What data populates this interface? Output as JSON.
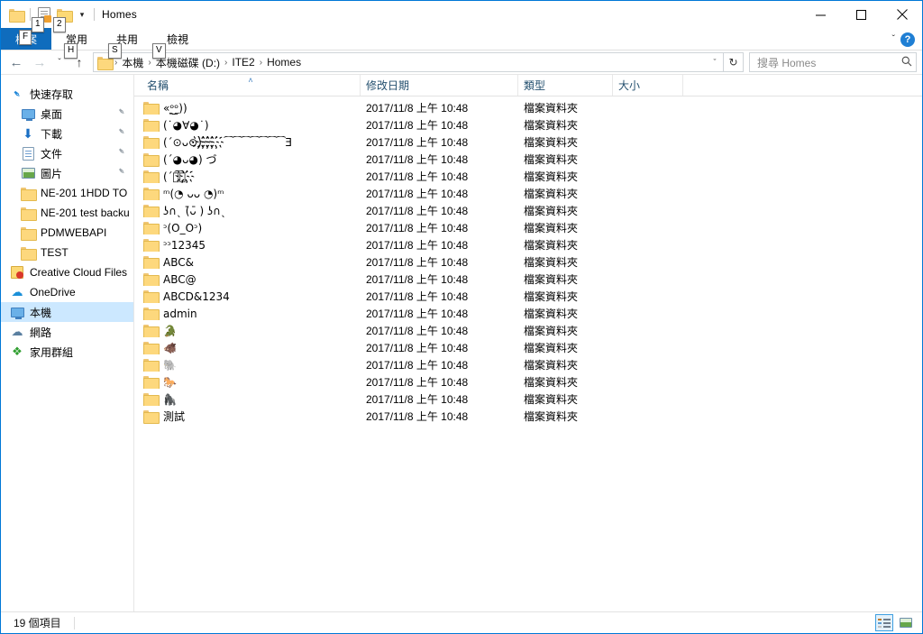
{
  "window": {
    "title": "Homes",
    "minimize_label": "─",
    "maximize_label": "□",
    "close_label": "✕"
  },
  "quick_access_toolbar": {
    "items": [
      {
        "name": "folder-icon",
        "keytip": ""
      },
      {
        "name": "properties-icon",
        "keytip": "1"
      },
      {
        "name": "new-folder-icon",
        "keytip": "2"
      }
    ],
    "customize_caret": "▾"
  },
  "ribbon": {
    "tabs": [
      {
        "label": "檔案",
        "keytip": "F",
        "selected": true
      },
      {
        "label": "常用",
        "keytip": "H",
        "selected": false
      },
      {
        "label": "共用",
        "keytip": "S",
        "selected": false
      },
      {
        "label": "檢視",
        "keytip": "V",
        "selected": false
      }
    ],
    "collapse_caret": "ˇ",
    "help_label": "?"
  },
  "address_bar": {
    "back_label": "←",
    "forward_label": "→",
    "history_label": "ˇ",
    "up_label": "↑",
    "breadcrumbs": [
      "本機",
      "本機磁碟 (D:)",
      "ITE2",
      "Homes"
    ],
    "separator": "›",
    "dropdown_caret": "ˇ",
    "refresh_label": "↻"
  },
  "search": {
    "placeholder": "搜尋 Homes",
    "icon_label": "⌕"
  },
  "sidebar": {
    "items": [
      {
        "label": "快速存取",
        "icon": "pin-blue-icon",
        "level": "root",
        "pinned": false,
        "selected": false
      },
      {
        "label": "桌面",
        "icon": "desktop-icon",
        "level": "sub",
        "pinned": true,
        "selected": false
      },
      {
        "label": "下載",
        "icon": "downloads-icon",
        "level": "sub",
        "pinned": true,
        "selected": false
      },
      {
        "label": "文件",
        "icon": "documents-icon",
        "level": "sub",
        "pinned": true,
        "selected": false
      },
      {
        "label": "圖片",
        "icon": "pictures-icon",
        "level": "sub",
        "pinned": true,
        "selected": false
      },
      {
        "label": "NE-201  1HDD TO",
        "icon": "folder-icon",
        "level": "sub",
        "pinned": false,
        "selected": false
      },
      {
        "label": "NE-201 test backu",
        "icon": "folder-icon",
        "level": "sub",
        "pinned": false,
        "selected": false
      },
      {
        "label": "PDMWEBAPI",
        "icon": "folder-icon",
        "level": "sub",
        "pinned": false,
        "selected": false
      },
      {
        "label": "TEST",
        "icon": "folder-icon",
        "level": "sub",
        "pinned": false,
        "selected": false
      },
      {
        "label": "Creative Cloud Files",
        "icon": "creative-cloud-icon",
        "level": "root",
        "pinned": false,
        "selected": false
      },
      {
        "label": "OneDrive",
        "icon": "onedrive-icon",
        "level": "root",
        "pinned": false,
        "selected": false
      },
      {
        "label": "本機",
        "icon": "this-pc-icon",
        "level": "root",
        "pinned": false,
        "selected": true
      },
      {
        "label": "網路",
        "icon": "network-icon",
        "level": "root",
        "pinned": false,
        "selected": false
      },
      {
        "label": "家用群組",
        "icon": "homegroup-icon",
        "level": "root",
        "pinned": false,
        "selected": false
      }
    ]
  },
  "file_list": {
    "columns": [
      {
        "label": "名稱",
        "sorted": true,
        "sort_arrow": "˄"
      },
      {
        "label": "修改日期",
        "sorted": false,
        "sort_arrow": ""
      },
      {
        "label": "類型",
        "sorted": false,
        "sort_arrow": ""
      },
      {
        "label": "大小",
        "sorted": false,
        "sort_arrow": ""
      }
    ],
    "rows": [
      {
        "name": "«ᵒ̯͜ᵒ̯))",
        "date": "2017/11/8 上午 10:48",
        "type": "檔案資料夾",
        "size": ""
      },
      {
        "name": "(˙◕∀◕˙)",
        "date": "2017/11/8 上午 10:48",
        "type": "檔案資料夾",
        "size": ""
      },
      {
        "name": "(´⊙ᴗ⊙)҉҉҉҉҉⁀⁀⁀⁀⁀⁀⁀Ǝ",
        "date": "2017/11/8 上午 10:48",
        "type": "檔案資料夾",
        "size": ""
      },
      {
        "name": "(´◕ᴗ◕) づ",
        "date": "2017/11/8 上午 10:48",
        "type": "檔案資料夾",
        "size": ""
      },
      {
        "name": "(´⍟͡⍟҉҉",
        "date": "2017/11/8 上午 10:48",
        "type": "檔案資料夾",
        "size": ""
      },
      {
        "name": "ᵐ(◔ ᴗᴗ ◔)ᵐ",
        "date": "2017/11/8 上午 10:48",
        "type": "檔案資料夾",
        "size": ""
      },
      {
        "name": "ʖ∩ˎ (̄ᴗ̄ ) ʖ∩ˎ",
        "date": "2017/11/8 上午 10:48",
        "type": "檔案資料夾",
        "size": ""
      },
      {
        "name": "ᵓ(O_Oᵓ)",
        "date": "2017/11/8 上午 10:48",
        "type": "檔案資料夾",
        "size": ""
      },
      {
        "name": "ᵓᵓ12345",
        "date": "2017/11/8 上午 10:48",
        "type": "檔案資料夾",
        "size": ""
      },
      {
        "name": "ABC&",
        "date": "2017/11/8 上午 10:48",
        "type": "檔案資料夾",
        "size": ""
      },
      {
        "name": "ABC@",
        "date": "2017/11/8 上午 10:48",
        "type": "檔案資料夾",
        "size": ""
      },
      {
        "name": "ABCD&1234",
        "date": "2017/11/8 上午 10:48",
        "type": "檔案資料夾",
        "size": ""
      },
      {
        "name": "admin",
        "date": "2017/11/8 上午 10:48",
        "type": "檔案資料夾",
        "size": ""
      },
      {
        "name": "🐊",
        "date": "2017/11/8 上午 10:48",
        "type": "檔案資料夾",
        "size": ""
      },
      {
        "name": "🐗",
        "date": "2017/11/8 上午 10:48",
        "type": "檔案資料夾",
        "size": ""
      },
      {
        "name": "🐘",
        "date": "2017/11/8 上午 10:48",
        "type": "檔案資料夾",
        "size": ""
      },
      {
        "name": "🐎",
        "date": "2017/11/8 上午 10:48",
        "type": "檔案資料夾",
        "size": ""
      },
      {
        "name": "🦍",
        "date": "2017/11/8 上午 10:48",
        "type": "檔案資料夾",
        "size": ""
      },
      {
        "name": "測試",
        "date": "2017/11/8 上午 10:48",
        "type": "檔案資料夾",
        "size": ""
      }
    ]
  },
  "status_bar": {
    "item_count": "19 個項目",
    "details_view_selected": true
  },
  "colors": {
    "accent": "#0f6cbd",
    "selection": "#cce8ff",
    "folder": "#fcd975",
    "help_blue": "#1f7fd4"
  }
}
